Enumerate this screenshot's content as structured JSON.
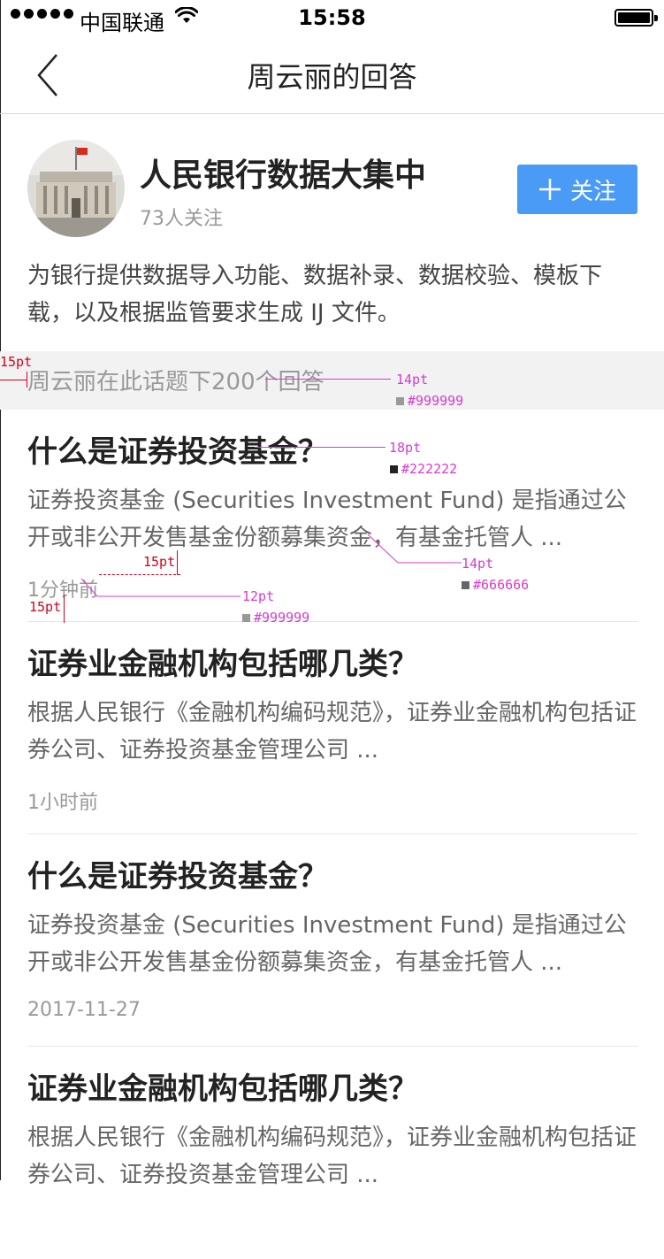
{
  "status_bar": {
    "carrier": "中国联通",
    "time": "15:58"
  },
  "nav": {
    "title": "周云丽的回答"
  },
  "topic": {
    "name": "人民银行数据大集中",
    "followers": "73人关注",
    "follow_label": "关注",
    "description": "为银行提供数据导入功能、数据补录、数据校验、模板下载，以及根据监管要求生成 IJ 文件。"
  },
  "answer_bar": {
    "text": "周云丽在此话题下200个回答"
  },
  "answers": [
    {
      "title": "什么是证券投资基金？",
      "excerpt": "证券投资基金 (Securities Investment Fund) 是指通过公开或非公开发售基金份额募集资金，有基金托管人 ...",
      "time": "1分钟前"
    },
    {
      "title": "证券业金融机构包括哪几类？",
      "excerpt": "根据人民银行《金融机构编码规范》，证券业金融机构包括证券公司、证券投资基金管理公司 ...",
      "time": "1小时前"
    },
    {
      "title": "什么是证券投资基金？",
      "excerpt": "证券投资基金 (Securities Investment Fund) 是指通过公开或非公开发售基金份额募集资金，有基金托管人 ...",
      "time": "2017-11-27"
    },
    {
      "title": "证券业金融机构包括哪几类？",
      "excerpt": "根据人民银行《金融机构编码规范》，证券业金融机构包括证券公司、证券投资基金管理公司 ...",
      "time": ""
    }
  ],
  "annotations": {
    "left_margin": "15pt",
    "bar_font": "14pt",
    "bar_color": "#999999",
    "title_font": "18pt",
    "title_color": "#222222",
    "excerpt_font": "14pt",
    "excerpt_color": "#666666",
    "gap_label": "15pt",
    "time_font": "12pt",
    "time_color": "#999999",
    "bottom_gap": "15pt"
  },
  "colors": {
    "accent": "#4a9bf5",
    "title": "#222222",
    "excerpt": "#666666",
    "meta": "#999999",
    "annotation": "#d43cd0",
    "annotation_red": "#d0021b"
  },
  "icons": {
    "back": "chevron-left-icon",
    "follow": "plus-icon",
    "wifi": "wifi-icon",
    "battery": "battery-icon",
    "signal": "signal-dots-icon"
  }
}
